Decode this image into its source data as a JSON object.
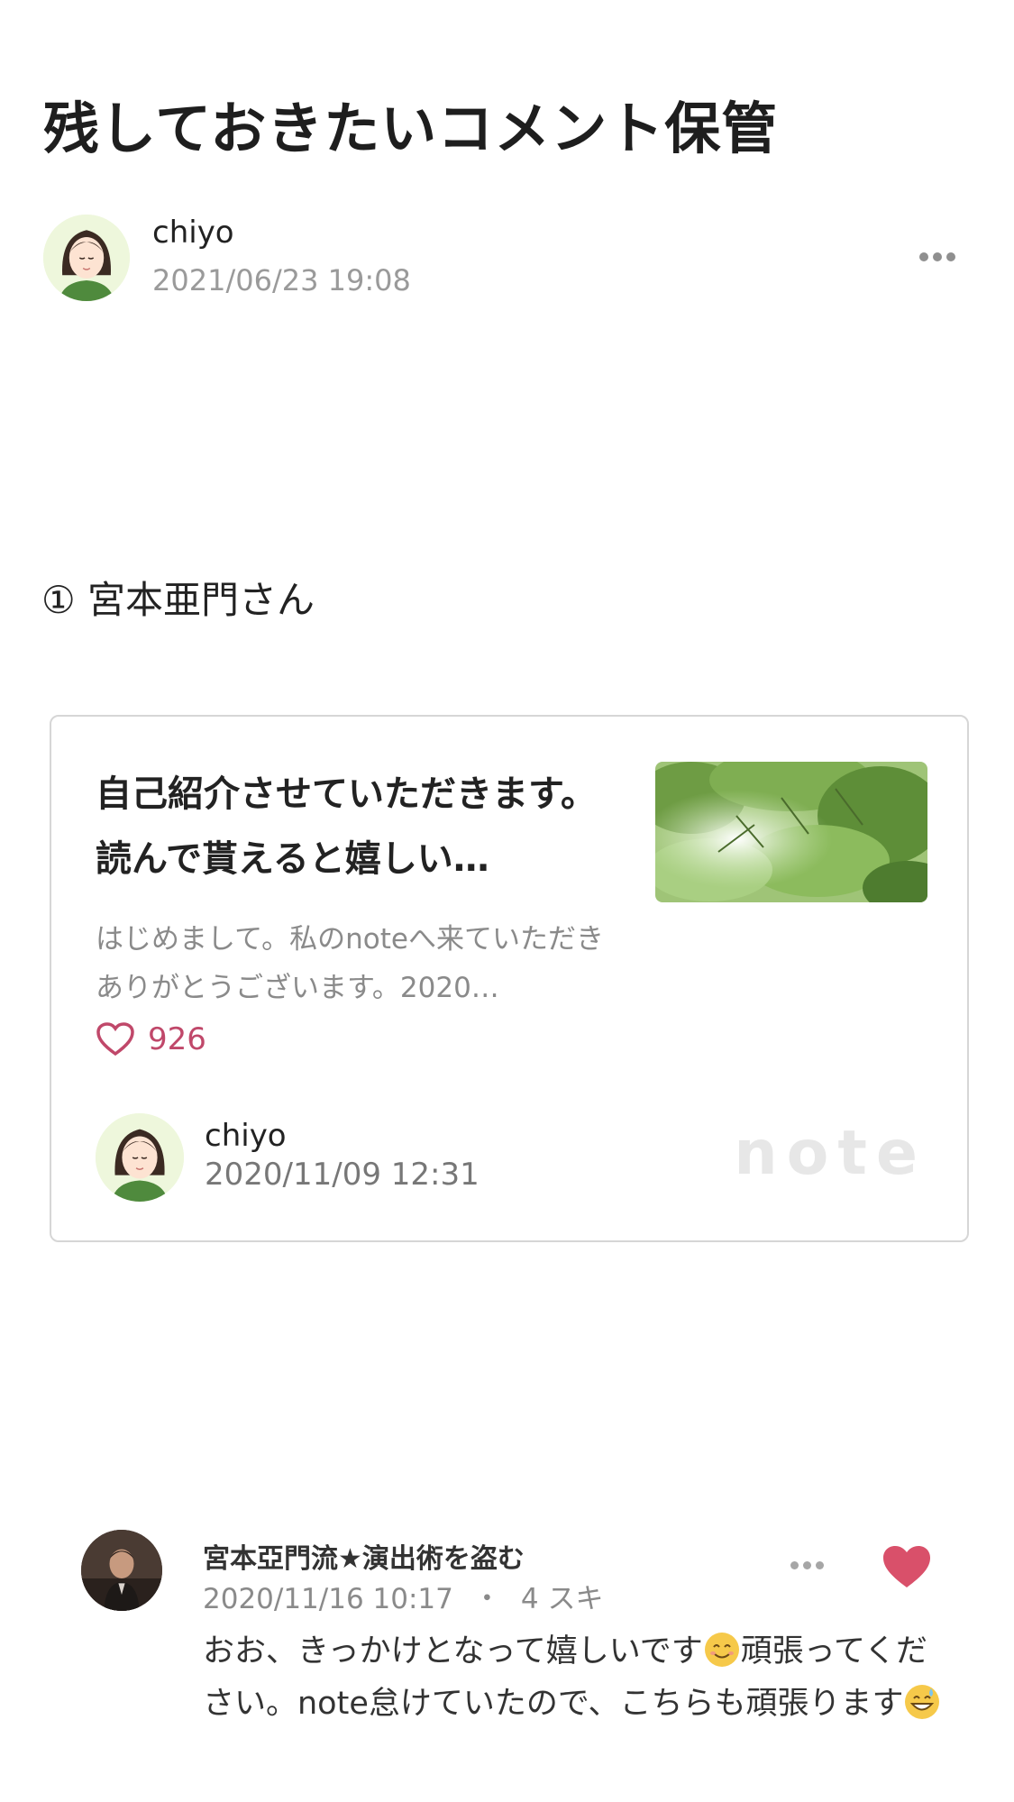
{
  "page": {
    "title": "残しておきたいコメント保管"
  },
  "author": {
    "name": "chiyo",
    "date": "2021/06/23 19:08",
    "avatar_icon": "woman-avatar-icon"
  },
  "post_menu_icon": "more-horizontal-icon",
  "section": {
    "heading": "① 宮本亜門さん"
  },
  "embed_card": {
    "title": "自己紹介させていただきます。読んで貰えると嬉しい…",
    "excerpt": "はじめまして。私のnoteへ来ていただきありがとうございます。2020…",
    "likes": "926",
    "like_icon": "heart-outline-icon",
    "author_name": "chiyo",
    "author_date": "2020/11/09 12:31",
    "brand": "note",
    "thumbnail": "green-leaves-image"
  },
  "comment": {
    "author": "宮本亞門流★演出術を盗む",
    "date": "2020/11/16 10:17",
    "separator": "・",
    "likes": "4 スキ",
    "body_part1": "おお、きっかけとなって嬉しいです",
    "body_part2": "頑張ってください。note怠けていたので、こちらも頑張ります",
    "emoji1": "smiling-face-emoji",
    "emoji2": "grinning-sweat-emoji",
    "like_icon": "heart-filled-icon",
    "colors": {
      "like": "#d9506a"
    }
  },
  "colors": {
    "accent_heart": "#c0486a",
    "muted_text": "#9a9a9a",
    "card_border": "#d6d6d6"
  }
}
